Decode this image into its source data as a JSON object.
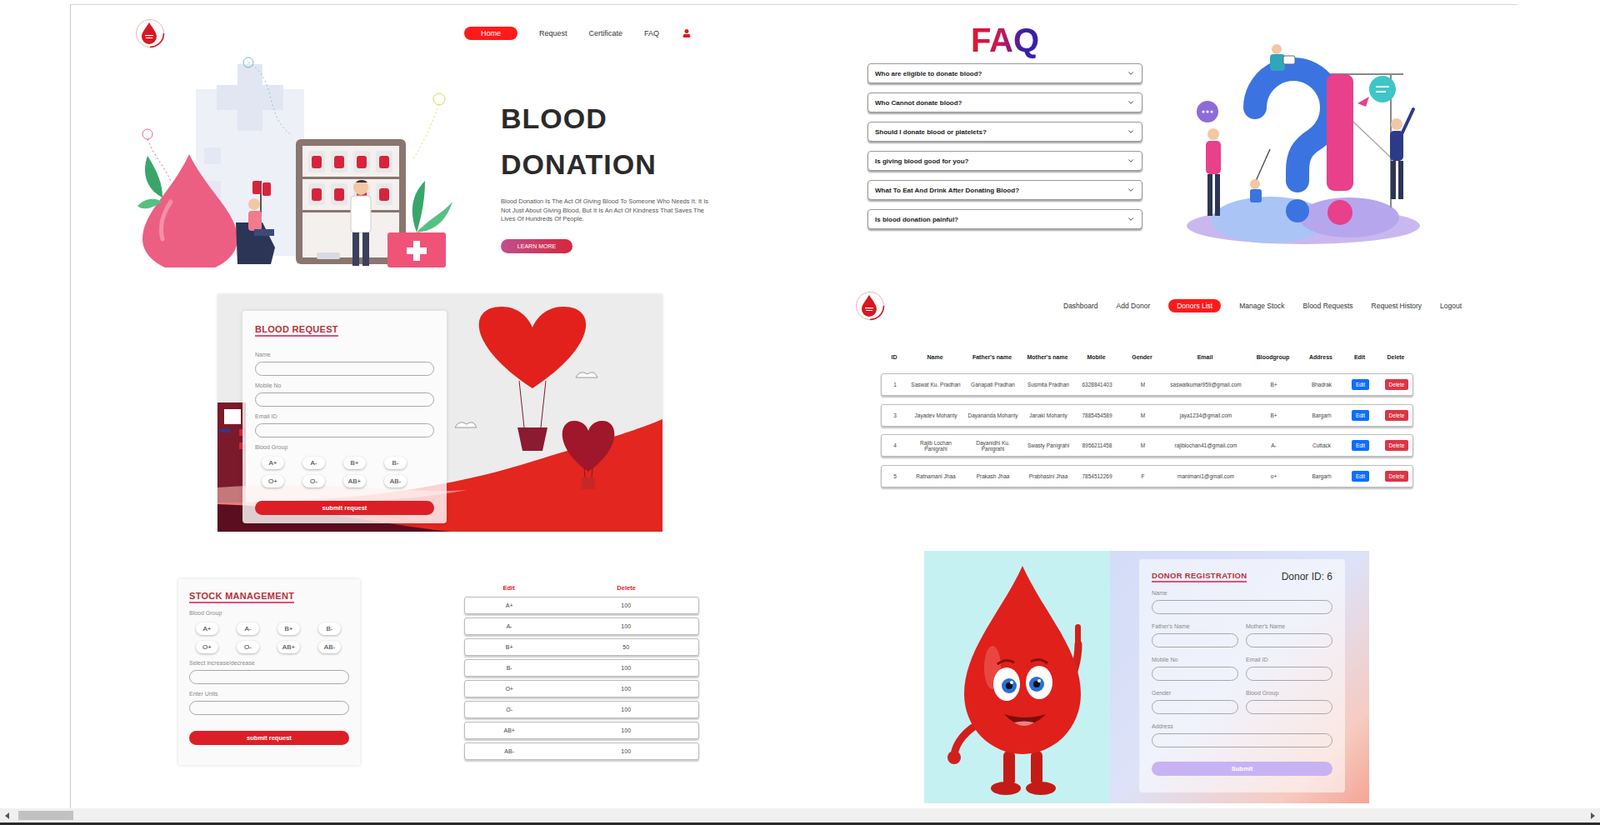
{
  "home": {
    "nav": [
      {
        "label": "Home",
        "selected": true
      },
      {
        "label": "Request",
        "selected": false
      },
      {
        "label": "Certificate",
        "selected": false
      },
      {
        "label": "FAQ",
        "selected": false
      }
    ],
    "hero": {
      "title_lines": [
        "BLOOD",
        "DONATION"
      ],
      "text": "Blood Donation Is The Act Of Giving Blood To Someone Who Needs It. It Is Not Just About Giving Blood, But It Is An Act Of Kindness That Saves The Lives Of Hundreds Of People.",
      "button": "LEARN MORE"
    }
  },
  "blood_request": {
    "title": "BLOOD REQUEST",
    "fields": [
      "Name",
      "Mobile No",
      "Email ID"
    ],
    "blood_group_label": "Blood Group",
    "blood_groups": [
      {
        "label": "A+",
        "selected": false
      },
      {
        "label": "A-",
        "selected": false
      },
      {
        "label": "B+",
        "selected": false
      },
      {
        "label": "B-",
        "selected": false
      },
      {
        "label": "O+",
        "selected": false
      },
      {
        "label": "O-",
        "selected": false
      },
      {
        "label": "AB+",
        "selected": false
      },
      {
        "label": "AB-",
        "selected": false
      }
    ],
    "submit": "submit request"
  },
  "stock_management": {
    "title": "STOCK MANAGEMENT",
    "blood_group_label": "Blood Group",
    "blood_groups": [
      {
        "label": "A+",
        "selected": false
      },
      {
        "label": "A-",
        "selected": false
      },
      {
        "label": "B+",
        "selected": false
      },
      {
        "label": "B-",
        "selected": false
      },
      {
        "label": "O+",
        "selected": false
      },
      {
        "label": "O-",
        "selected": false
      },
      {
        "label": "AB+",
        "selected": false
      },
      {
        "label": "AB-",
        "selected": false
      }
    ],
    "fields": [
      "Select increase/decrease",
      "Enter Units"
    ],
    "submit": "submit request"
  },
  "stock_table": {
    "columns": [
      "Edit",
      "Delete"
    ],
    "rows": [
      {
        "group": "A+",
        "units": "100"
      },
      {
        "group": "A-",
        "units": "100"
      },
      {
        "group": "B+",
        "units": "50"
      },
      {
        "group": "B-",
        "units": "100"
      },
      {
        "group": "O+",
        "units": "100"
      },
      {
        "group": "O-",
        "units": "100"
      },
      {
        "group": "AB+",
        "units": "100"
      },
      {
        "group": "AB-",
        "units": "100"
      }
    ]
  },
  "faq": {
    "title": "FAQ",
    "items": [
      {
        "question": "Who are eligible to donate blood?",
        "expanded": false
      },
      {
        "question": "Who Cannot donate blood?",
        "expanded": false
      },
      {
        "question": "Should I donate blood or platelets?",
        "expanded": false
      },
      {
        "question": "Is giving blood good for you?",
        "expanded": false
      },
      {
        "question": "What To Eat And Drink After Donating Blood?",
        "expanded": false
      },
      {
        "question": "Is blood donation painful?",
        "expanded": false
      }
    ]
  },
  "admin": {
    "nav": [
      {
        "label": "Dashboard",
        "selected": false
      },
      {
        "label": "Add Donor",
        "selected": false
      },
      {
        "label": "Donors List",
        "selected": true
      },
      {
        "label": "Manage Stock",
        "selected": false
      },
      {
        "label": "Blood Requests",
        "selected": false
      },
      {
        "label": "Request History",
        "selected": false
      },
      {
        "label": "Logout",
        "selected": false
      }
    ],
    "table": {
      "columns": [
        "ID",
        "Name",
        "Father's name",
        "Mother's name",
        "Mobile",
        "Gender",
        "Email",
        "Bloodgroup",
        "Address",
        "Edit",
        "Delete"
      ],
      "actions": {
        "edit": "Edit",
        "delete": "Delete"
      },
      "rows": [
        {
          "cells": [
            "1",
            "Saswat Ku. Pradhan",
            "Ganapati Pradhan",
            "Susmita Pradhan",
            "6328841403",
            "M",
            "saswatkumar959@gmail.com",
            "B+",
            "Bhadrak"
          ]
        },
        {
          "cells": [
            "3",
            "Jayadev Mohanty",
            "Dayananda Mohanty",
            "Janaki Mohanty",
            "7885454589",
            "M",
            "jaya1234@gmail.com",
            "B+",
            "Bargarh"
          ]
        },
        {
          "cells": [
            "4",
            "Rajib Lochan Panigrahi",
            "Dayanidhi Ku. Panigrahi",
            "Swasty Panigrahi",
            "8956211458",
            "M",
            "rajiblochan41@gmail.com",
            "A-",
            "Cuttack"
          ]
        },
        {
          "cells": [
            "5",
            "Ratnamani Jhaa",
            "Prakash Jhaa",
            "Prabhasini Jhaa",
            "7854512269",
            "F",
            "manimani1@gmail.com",
            "o+",
            "Bargarh"
          ]
        }
      ]
    }
  },
  "donor_registration": {
    "title": "DONOR REGISTRATION",
    "donor_id": "Donor ID: 6",
    "field_rows": [
      [
        "Name"
      ],
      [
        "Father's Name",
        "Mother's Name"
      ],
      [
        "Mobile No",
        "Email ID"
      ],
      [
        "Gender",
        "Blood Group"
      ],
      [
        "Address"
      ]
    ],
    "submit": "Submit",
    "submit_disabled": true
  },
  "scrollbar": {
    "level": 0.035
  }
}
